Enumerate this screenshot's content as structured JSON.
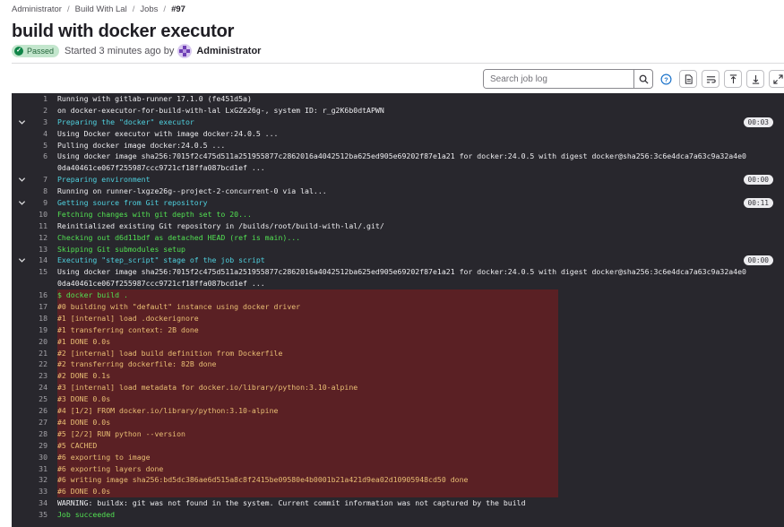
{
  "breadcrumb": [
    "Administrator",
    "Build With Lal",
    "Jobs",
    "#97"
  ],
  "title": "build with docker executor",
  "status": {
    "badge": "Passed",
    "started_text": "Started 3 minutes ago by",
    "user": "Administrator"
  },
  "toolbar": {
    "search_placeholder": "Search job log"
  },
  "colors": {
    "log_background": "#28272d",
    "highlight_background": "#5a2024",
    "cyan": "#4fd1df",
    "green": "#52e052",
    "orange": "#e9be74",
    "passed": "#108548"
  },
  "log": [
    {
      "n": "1",
      "text": "Running with gitlab-runner 17.1.0 (fe451d5a)",
      "color": "default"
    },
    {
      "n": "2",
      "text": "  on docker-executor-for-build-with-lal LxGZe26g-, system ID: r_g2K6b0dtAPWN",
      "color": "default"
    },
    {
      "n": "3",
      "text": "Preparing the \"docker\" executor",
      "color": "cyan",
      "section": true,
      "dur": "00:03"
    },
    {
      "n": "4",
      "text": "Using Docker executor with image docker:24.0.5 ...",
      "color": "default"
    },
    {
      "n": "5",
      "text": "Pulling docker image docker:24.0.5 ...",
      "color": "default"
    },
    {
      "n": "6",
      "text": "Using docker image sha256:7015f2c475d511a251955877c2862016a4042512ba625ed905e69202f87e1a21 for docker:24.0.5 with digest docker@sha256:3c6e4dca7a63c9a32a4e0",
      "color": "default"
    },
    {
      "n": "",
      "text": "0da40461ce067f255987ccc9721cf18ffa087bcd1ef ...",
      "color": "default"
    },
    {
      "n": "7",
      "text": "Preparing environment",
      "color": "cyan",
      "section": true,
      "dur": "00:00"
    },
    {
      "n": "8",
      "text": "Running on runner-lxgze26g--project-2-concurrent-0 via lal...",
      "color": "default"
    },
    {
      "n": "9",
      "text": "Getting source from Git repository",
      "color": "cyan",
      "section": true,
      "dur": "00:11"
    },
    {
      "n": "10",
      "text": "Fetching changes with git depth set to 20...",
      "color": "green"
    },
    {
      "n": "11",
      "text": "Reinitialized existing Git repository in /builds/root/build-with-lal/.git/",
      "color": "default"
    },
    {
      "n": "12",
      "text": "Checking out d6d11bdf as detached HEAD (ref is main)...",
      "color": "green"
    },
    {
      "n": "13",
      "text": "Skipping Git submodules setup",
      "color": "green"
    },
    {
      "n": "14",
      "text": "Executing \"step_script\" stage of the job script",
      "color": "cyan",
      "section": true,
      "dur": "00:00"
    },
    {
      "n": "15",
      "text": "Using docker image sha256:7015f2c475d511a251955877c2862016a4042512ba625ed905e69202f87e1a21 for docker:24.0.5 with digest docker@sha256:3c6e4dca7a63c9a32a4e0",
      "color": "default"
    },
    {
      "n": "",
      "text": "0da40461ce067f255987ccc9721cf18ffa087bcd1ef ...",
      "color": "default"
    },
    {
      "n": "16",
      "text": "$ docker build .",
      "color": "green",
      "hl": true
    },
    {
      "n": "17",
      "text": "#0 building with \"default\" instance using docker driver",
      "color": "orange",
      "hl": true
    },
    {
      "n": "18",
      "text": "#1 [internal] load .dockerignore",
      "color": "orange",
      "hl": true
    },
    {
      "n": "19",
      "text": "#1 transferring context: 2B done",
      "color": "orange",
      "hl": true
    },
    {
      "n": "20",
      "text": "#1 DONE 0.0s",
      "color": "orange",
      "hl": true
    },
    {
      "n": "21",
      "text": "#2 [internal] load build definition from Dockerfile",
      "color": "orange",
      "hl": true
    },
    {
      "n": "22",
      "text": "#2 transferring dockerfile: 82B done",
      "color": "orange",
      "hl": true
    },
    {
      "n": "23",
      "text": "#2 DONE 0.1s",
      "color": "orange",
      "hl": true
    },
    {
      "n": "24",
      "text": "#3 [internal] load metadata for docker.io/library/python:3.10-alpine",
      "color": "orange",
      "hl": true
    },
    {
      "n": "25",
      "text": "#3 DONE 0.0s",
      "color": "orange",
      "hl": true
    },
    {
      "n": "26",
      "text": "#4 [1/2] FROM docker.io/library/python:3.10-alpine",
      "color": "orange",
      "hl": true
    },
    {
      "n": "27",
      "text": "#4 DONE 0.0s",
      "color": "orange",
      "hl": true
    },
    {
      "n": "28",
      "text": "#5 [2/2] RUN python --version",
      "color": "orange",
      "hl": true
    },
    {
      "n": "29",
      "text": "#5 CACHED",
      "color": "orange",
      "hl": true
    },
    {
      "n": "30",
      "text": "#6 exporting to image",
      "color": "orange",
      "hl": true
    },
    {
      "n": "31",
      "text": "#6 exporting layers done",
      "color": "orange",
      "hl": true
    },
    {
      "n": "32",
      "text": "#6 writing image sha256:bd5dc386ae6d515a8c8f2415be09580e4b0001b21a421d9ea02d10905948cd50 done",
      "color": "orange",
      "hl": true
    },
    {
      "n": "33",
      "text": "#6 DONE 0.0s",
      "color": "orange",
      "hl": true
    },
    {
      "n": "34",
      "text": "WARNING: buildx: git was not found in the system. Current commit information was not captured by the build",
      "color": "default"
    },
    {
      "n": "35",
      "text": "Job succeeded",
      "color": "green"
    }
  ]
}
